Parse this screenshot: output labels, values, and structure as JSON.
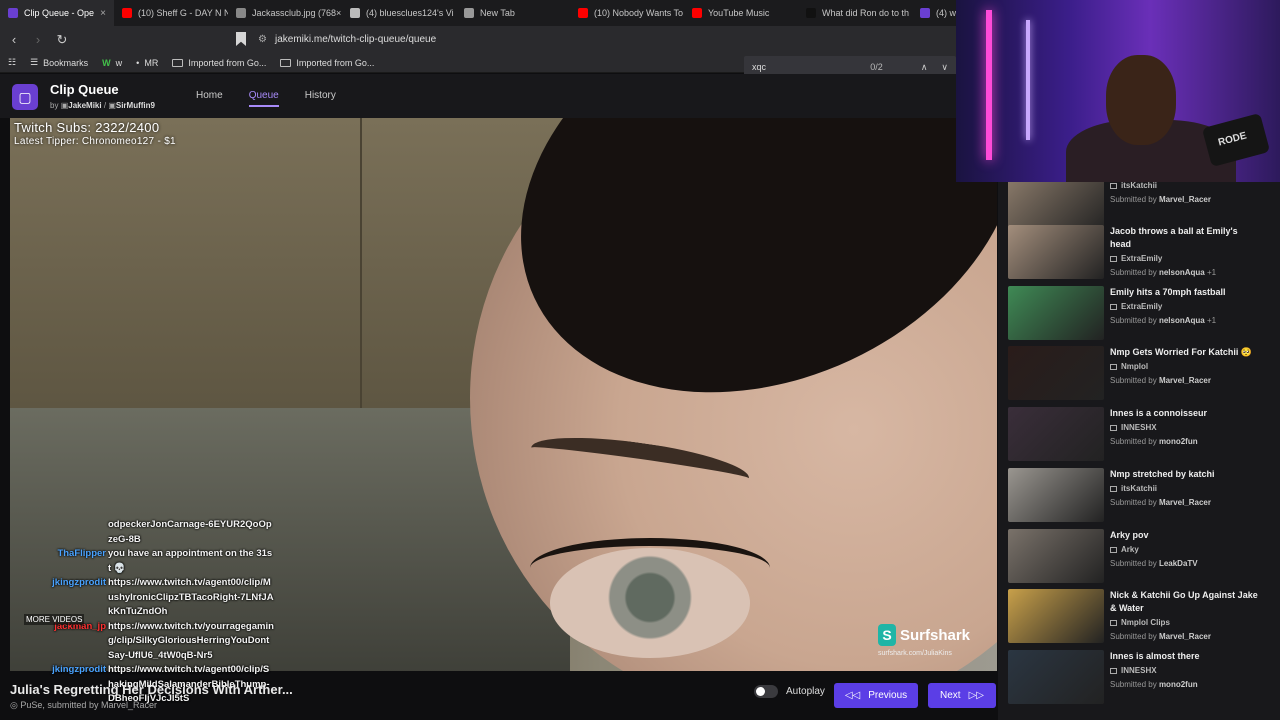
{
  "browser": {
    "tabs": [
      {
        "label": "Clip Queue - Ope",
        "color": "#6a3fd1",
        "active": true
      },
      {
        "label": "(10) Sheff G - DAY N N",
        "color": "#ff0000"
      },
      {
        "label": "Jackassclub.jpg (768×",
        "color": "#888888"
      },
      {
        "label": "(4) bluesclues124's Vi",
        "color": "#bbbbbb"
      },
      {
        "label": "New Tab",
        "color": "#999999"
      },
      {
        "label": "(10) Nobody Wants To",
        "color": "#ff0000"
      },
      {
        "label": "YouTube Music",
        "color": "#ff0000"
      },
      {
        "label": "What did Ron do to th",
        "color": "#111111"
      },
      {
        "label": "(4) w",
        "color": "#6a3fd1"
      }
    ],
    "url": "jakemiki.me/twitch-clip-queue/queue",
    "bookmarks": [
      {
        "label": "Bookmarks",
        "icon": "bookmarks-icon"
      },
      {
        "label": "w",
        "icon": "w-icon"
      },
      {
        "label": "MR",
        "icon": "mr-icon"
      },
      {
        "label": "Imported from Go...",
        "icon": "folder-icon"
      },
      {
        "label": "Imported from Go...",
        "icon": "folder-icon"
      }
    ],
    "find": {
      "query": "xqc",
      "count": "0/2"
    }
  },
  "app": {
    "title": "Clip Queue",
    "by_prefix": "by",
    "author1": "JakeMiki",
    "separator": "/",
    "author2": "SirMuffin9",
    "nav": [
      "Home",
      "Queue",
      "History"
    ],
    "active_nav": "Queue"
  },
  "overlay": {
    "subs": "Twitch Subs: 2322/2400",
    "tipper": "Latest Tipper: Chronomeo127 - $1",
    "sponsor": "Surfshark",
    "sponsor_url": "surfshark.com/JuliaKins",
    "more_videos": "MORE VIDEOS"
  },
  "chat": [
    {
      "user": "",
      "text": "odpeckerJonCarnage-6EYUR2QoOpzeG-8B"
    },
    {
      "user": "ThaFlipper",
      "text": "you have an appointment on the 31st 💀"
    },
    {
      "user": "jkingzprodit",
      "text": "https://www.twitch.tv/agent00/clip/MushyIronicClipzTBTacoRight-7LNfJAkKnTuZndOh"
    },
    {
      "user": "jackman_jp",
      "text": "https://www.twitch.tv/yourragegaming/clip/SilkyGloriousHerringYouDontSay-UfIU6_4tW0qB-Nr5"
    },
    {
      "user": "jkingzprodit",
      "text": "https://www.twitch.tv/agent00/clip/ShakingMildSalamanderBibleThump-DBheoFIjVJcJI5tS"
    }
  ],
  "player": {
    "clip_title": "Julia's Regretting Her Decisions With Arther...",
    "channel": "PuSe",
    "submitted_by_label": "submitted by",
    "submitter": "Marvel_Racer",
    "autoplay_label": "Autoplay",
    "autoplay_on": false,
    "previous_label": "Previous",
    "next_label": "Next"
  },
  "queue": [
    {
      "title": "",
      "channel": "itsKatchii",
      "submitter": "Marvel_Racer",
      "extra": "",
      "thumb": "#8a7a6a"
    },
    {
      "title": "Jacob throws a ball at Emily's head",
      "channel": "ExtraEmily",
      "submitter": "nelsonAqua",
      "extra": "+1",
      "thumb": "#a38e7c"
    },
    {
      "title": "Emily hits a 70mph fastball",
      "channel": "ExtraEmily",
      "submitter": "nelsonAqua",
      "extra": "+1",
      "thumb": "#3f8a55"
    },
    {
      "title": "Nmp Gets Worried For Katchii 🥺",
      "channel": "Nmplol",
      "submitter": "Marvel_Racer",
      "extra": "",
      "thumb": "#2a1c1a"
    },
    {
      "title": "Innes is a connoisseur",
      "channel": "INNESHX",
      "submitter": "mono2fun",
      "extra": "",
      "thumb": "#3a2e3a"
    },
    {
      "title": "Nmp stretched by katchi",
      "channel": "itsKatchii",
      "submitter": "Marvel_Racer",
      "extra": "",
      "thumb": "#9a9690"
    },
    {
      "title": "Arky pov",
      "channel": "Arky",
      "submitter": "LeakDaTV",
      "extra": "",
      "thumb": "#7a726a"
    },
    {
      "title": "Nick & Katchii Go Up Against Jake & Water",
      "channel": "Nmplol Clips",
      "submitter": "Marvel_Racer",
      "extra": "",
      "thumb": "#c8a04a"
    },
    {
      "title": "Innes is almost there",
      "channel": "INNESHX",
      "submitter": "mono2fun",
      "extra": "",
      "thumb": "#2b3642"
    }
  ],
  "queue_labels": {
    "submitted_by": "Submitted by"
  },
  "webcam": {
    "mic_brand": "RODE"
  }
}
